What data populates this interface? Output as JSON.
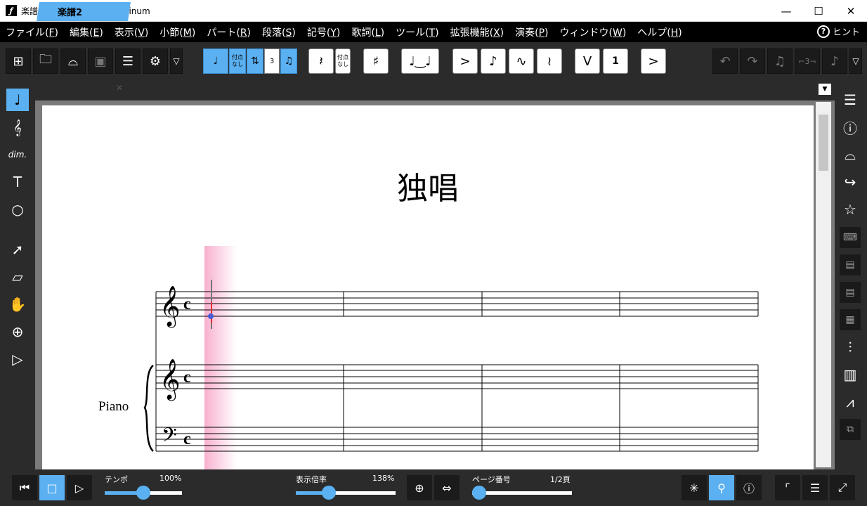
{
  "titlebar": {
    "app_icon": "𝆑",
    "title": "楽譜2 - スコアメーカー Platinum",
    "minimize": "—",
    "maximize": "☐",
    "close": "✕"
  },
  "menu": [
    {
      "label": "ファイル(",
      "key": "F",
      "end": ")"
    },
    {
      "label": "編集(",
      "key": "E",
      "end": ")"
    },
    {
      "label": "表示(",
      "key": "V",
      "end": ")"
    },
    {
      "label": "小節(",
      "key": "M",
      "end": ")"
    },
    {
      "label": "パート(",
      "key": "R",
      "end": ")"
    },
    {
      "label": "段落(",
      "key": "S",
      "end": ")"
    },
    {
      "label": "記号(",
      "key": "Y",
      "end": ")"
    },
    {
      "label": "歌詞(",
      "key": "L",
      "end": ")"
    },
    {
      "label": "ツール(",
      "key": "T",
      "end": ")"
    },
    {
      "label": "拡張機能(",
      "key": "X",
      "end": ")"
    },
    {
      "label": "演奏(",
      "key": "P",
      "end": ")"
    },
    {
      "label": "ウィンドウ(",
      "key": "W",
      "end": ")"
    },
    {
      "label": "ヘルプ(",
      "key": "H",
      "end": ")"
    }
  ],
  "hint": {
    "icon": "?",
    "label": "ヒント"
  },
  "toolbar": {
    "dotted_label": "付点\nなし",
    "triplet_label": "3",
    "rest_dotted_label": "付点\nなし",
    "number_one": "1"
  },
  "tab": {
    "name": "楽譜2",
    "close": "✕",
    "dropdown": "▼"
  },
  "score": {
    "title": "独唱",
    "part_label": "Piano"
  },
  "status": {
    "tempo_label": "テンポ",
    "tempo_value": "100%",
    "zoom_label": "表示倍率",
    "zoom_value": "138%",
    "page_label": "ページ番号",
    "page_value": "1/2頁",
    "tempo_level": 0.5,
    "zoom_level": 0.33,
    "page_level": 0.0
  },
  "left_tools": [
    "note-input-icon",
    "clef-pencil-icon",
    "dim-text-icon",
    "lyrics-text-icon",
    "shapes-icon",
    "select-arrow-icon",
    "eraser-icon",
    "hand-icon",
    "zoom-icon",
    "play-triangle-icon"
  ],
  "lefttext": {
    "dim": "dim."
  },
  "colors": {
    "accent": "#5ab0f0",
    "cursor": "#f8b0cf"
  }
}
